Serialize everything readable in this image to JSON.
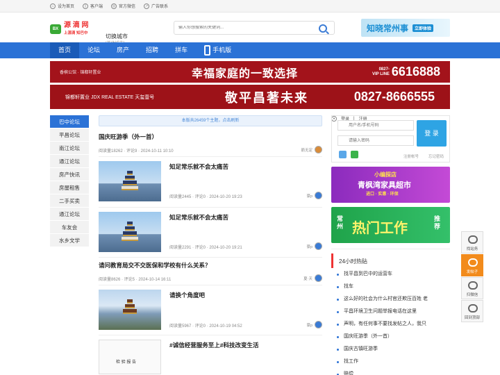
{
  "topbar": {
    "left": [
      "设为首页",
      "客户端",
      "官方微信",
      "广告联系"
    ],
    "login": "登录",
    "sep": "|",
    "register": "注册"
  },
  "logo": {
    "badge": "BX",
    "name": "源 滴 网",
    "sub": "上源滴  知巴中"
  },
  "city": {
    "name": "切换城市",
    "sub": "[其他城市]"
  },
  "search": {
    "placeholder": "输入你想搜索的关键词..."
  },
  "header_banner": {
    "text": "知晓常州事",
    "tag": "立即体验"
  },
  "nav": {
    "items": [
      "首页",
      "论坛",
      "房产",
      "招聘",
      "拼车"
    ],
    "mobile": "手机版"
  },
  "ad1": {
    "brand": "香槟公馆 · 锦都轩置业",
    "slogan": "幸福家庭的一致选择",
    "vip": "0827-",
    "vip2": "VIP LINE",
    "tel": "6616888"
  },
  "ad2": {
    "brand": "锦都轩置业 JDX REAL ESTATE   天玺壹号",
    "slogan": "敬平昌著未来",
    "tel": "0827-8666555"
  },
  "sidebar": [
    "巴中论坛",
    "平昌论坛",
    "南江论坛",
    "通江论坛",
    "房产快讯",
    "房屋租售",
    "二手买卖",
    "通江论坛",
    "车友会",
    "水乡文学"
  ],
  "notice": "本版共26459个主题，点击刷新",
  "posts": [
    {
      "title": "国庆旺游季（外一首）",
      "meta": "阅读量18262 · 评论9 · 2024-10-11 10:10",
      "author": "箭无定"
    },
    {
      "title": "知足常乐就不会太痛苦",
      "meta": "阅读量2445 · 评论0 · 2024-10-20 19:23",
      "author": "豪p"
    },
    {
      "title": "知足常乐就不会太痛苦",
      "meta": "阅读量2291 · 评论0 · 2024-10-20 19:21",
      "author": "豪p"
    },
    {
      "title": "请问教育局交不交医保和学校有什么关系？",
      "meta": "阅读量8626 · 评论5 · 2024-10-14 16:11",
      "author": "夏·天"
    },
    {
      "title": "请换个角度吧",
      "meta": "阅读量5967 · 评论0 · 2024-10-19 04:52",
      "author": "豪p"
    },
    {
      "title": "#诚信经营服务至上#科技改变生活",
      "doc": "检 验 报 告"
    }
  ],
  "login": {
    "user_placeholder": "用户名/手机号码",
    "pass_placeholder": "请输入密码",
    "button": "登 录",
    "register": "注册帐号",
    "forgot": "忘记密码"
  },
  "side_ads": [
    {
      "line1": "小编探店",
      "line2": "青枫湾家具超市",
      "line3": "进口 · 实惠 · 环保"
    },
    {
      "line1": "常州",
      "line2": "热门工作",
      "line3": "推荐"
    }
  ],
  "hot": {
    "title": "24小时热贴",
    "items": [
      "找平昌到巴中的运营车",
      "找车",
      "这么好的社会为什么村官还欺压百姓 老",
      "平昌环境卫生问题举报电话在这里",
      "声明，有任何事不要找发帖之人，我只",
      "国庆旺游季（外一首）",
      "国庆古镇旺游季",
      "找工作",
      "赔偿"
    ]
  },
  "float": [
    "找站务",
    "发帖子",
    "扫微信",
    "回到顶部"
  ],
  "colors": {
    "brand": "#2b72d6",
    "accent": "#e33",
    "orange": "#f28b1c"
  }
}
